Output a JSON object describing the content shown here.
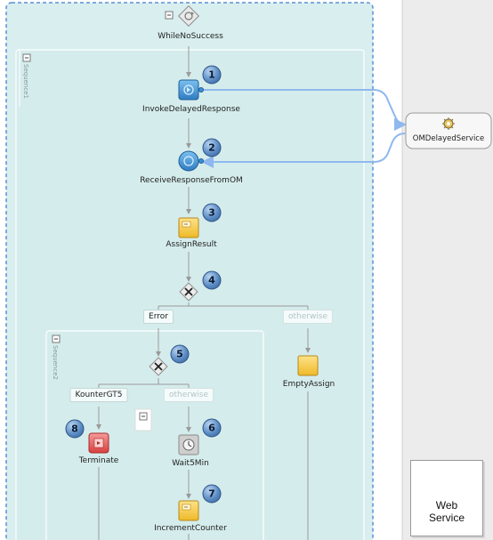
{
  "loop": {
    "label": "WhileNoSuccess"
  },
  "sequences": [
    {
      "label": "Sequence1"
    },
    {
      "label": "Sequence2"
    }
  ],
  "activities": [
    {
      "id": "invoke",
      "label": "InvokeDelayedResponse",
      "number": "1",
      "type": "invoke"
    },
    {
      "id": "receive",
      "label": "ReceiveResponseFromOM",
      "number": "2",
      "type": "receive"
    },
    {
      "id": "assign-result",
      "label": "AssignResult",
      "number": "3",
      "type": "assign"
    },
    {
      "id": "switch1",
      "label": "",
      "number": "4",
      "type": "switch"
    },
    {
      "id": "switch2",
      "label": "",
      "number": "5",
      "type": "switch"
    },
    {
      "id": "wait",
      "label": "Wait5Min",
      "number": "6",
      "type": "wait"
    },
    {
      "id": "increment",
      "label": "IncrementCounter",
      "number": "7",
      "type": "assign"
    },
    {
      "id": "terminate",
      "label": "Terminate",
      "number": "8",
      "type": "terminate"
    },
    {
      "id": "empty-assign",
      "label": "EmptyAssign",
      "number": "",
      "type": "assign"
    }
  ],
  "branches": {
    "error": "Error",
    "otherwise1": "otherwise",
    "kounter": "KounterGT5",
    "otherwise2": "otherwise"
  },
  "partner_link": {
    "label": "OMDelayedService"
  },
  "palette": {
    "web_service": "Web Service"
  },
  "colors": {
    "scope_bg": "#d9eeee",
    "scope_border": "#5a8fd6",
    "lane_bg": "#ececec",
    "wire": "#8fb8ee",
    "assign": "#f3c64a",
    "terminate": "#e85a5a",
    "invoke": "#3d8fd0"
  }
}
